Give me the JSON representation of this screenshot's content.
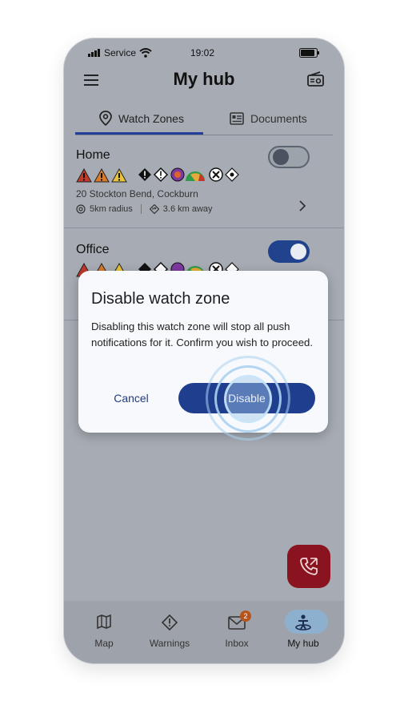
{
  "status_bar": {
    "carrier": "Service",
    "time": "19:02"
  },
  "header": {
    "title": "My hub",
    "menu_icon": "menu-icon",
    "radio_icon": "radio-icon"
  },
  "tabs": [
    {
      "label": "Watch Zones",
      "icon": "location-pin-icon",
      "selected": true
    },
    {
      "label": "Documents",
      "icon": "document-icon",
      "selected": false
    }
  ],
  "zones": [
    {
      "name": "Home",
      "address": "20 Stockton Bend, Cockburn",
      "radius": "5km radius",
      "distance": "3.6 km away",
      "enabled": false
    },
    {
      "name": "Office",
      "enabled": true
    }
  ],
  "dialog": {
    "title": "Disable watch zone",
    "body": "Disabling this watch zone will stop all push notifications for it. Confirm you wish to proceed.",
    "cancel_label": "Cancel",
    "confirm_label": "Disable"
  },
  "nav": [
    {
      "label": "Map",
      "icon": "map-icon"
    },
    {
      "label": "Warnings",
      "icon": "warning-icon"
    },
    {
      "label": "Inbox",
      "icon": "mail-icon",
      "badge": "2"
    },
    {
      "label": "My hub",
      "icon": "hub-icon",
      "selected": true
    }
  ],
  "colors": {
    "accent": "#1f3f8e",
    "fab": "#8a1320",
    "badge": "#b5541b",
    "overlay_bg": "#a7acb4"
  }
}
